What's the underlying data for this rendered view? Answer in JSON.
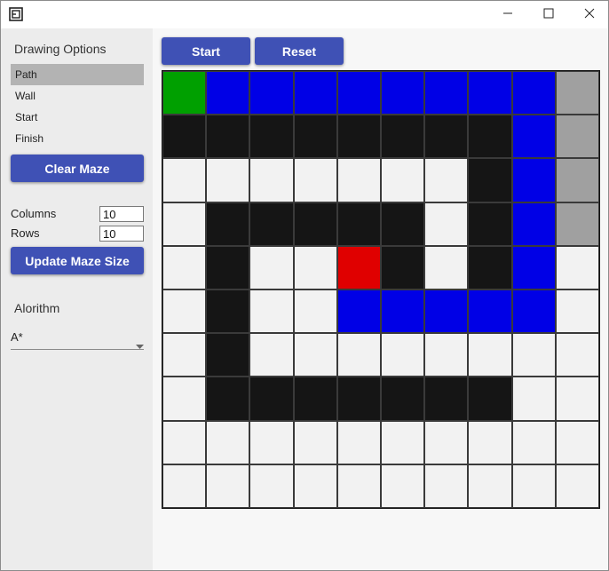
{
  "sidebar": {
    "drawing_options_title": "Drawing Options",
    "drawing_options": [
      "Path",
      "Wall",
      "Start",
      "Finish"
    ],
    "selected_option": "Path",
    "clear_maze_label": "Clear Maze",
    "columns_label": "Columns",
    "columns_value": "10",
    "rows_label": "Rows",
    "rows_value": "10",
    "update_size_label": "Update Maze Size",
    "algorithm_title": "Alorithm",
    "algorithm_value": "A*"
  },
  "toolbar": {
    "start_label": "Start",
    "reset_label": "Reset"
  },
  "colors": {
    "accent": "#3f51b5",
    "empty": "#f2f2f2",
    "wall": "#151515",
    "path": "#0000e6",
    "start": "#00a000",
    "finish": "#e00000",
    "visited": "#a0a0a0"
  },
  "maze": {
    "columns": 10,
    "rows": 10,
    "legend_codes": {
      "E": "empty",
      "W": "wall",
      "P": "path",
      "S": "start",
      "F": "finish",
      "V": "visited"
    },
    "cells": [
      [
        "S",
        "P",
        "P",
        "P",
        "P",
        "P",
        "P",
        "P",
        "P",
        "V"
      ],
      [
        "W",
        "W",
        "W",
        "W",
        "W",
        "W",
        "W",
        "W",
        "P",
        "V"
      ],
      [
        "E",
        "E",
        "E",
        "E",
        "E",
        "E",
        "E",
        "W",
        "P",
        "V"
      ],
      [
        "E",
        "W",
        "W",
        "W",
        "W",
        "W",
        "E",
        "W",
        "P",
        "V"
      ],
      [
        "E",
        "W",
        "E",
        "E",
        "F",
        "W",
        "E",
        "W",
        "P",
        "E"
      ],
      [
        "E",
        "W",
        "E",
        "E",
        "P",
        "P",
        "P",
        "P",
        "P",
        "E"
      ],
      [
        "E",
        "W",
        "E",
        "E",
        "E",
        "E",
        "E",
        "E",
        "E",
        "E"
      ],
      [
        "E",
        "W",
        "W",
        "W",
        "W",
        "W",
        "W",
        "W",
        "E",
        "E"
      ],
      [
        "E",
        "E",
        "E",
        "E",
        "E",
        "E",
        "E",
        "E",
        "E",
        "E"
      ],
      [
        "E",
        "E",
        "E",
        "E",
        "E",
        "E",
        "E",
        "E",
        "E",
        "E"
      ]
    ]
  }
}
